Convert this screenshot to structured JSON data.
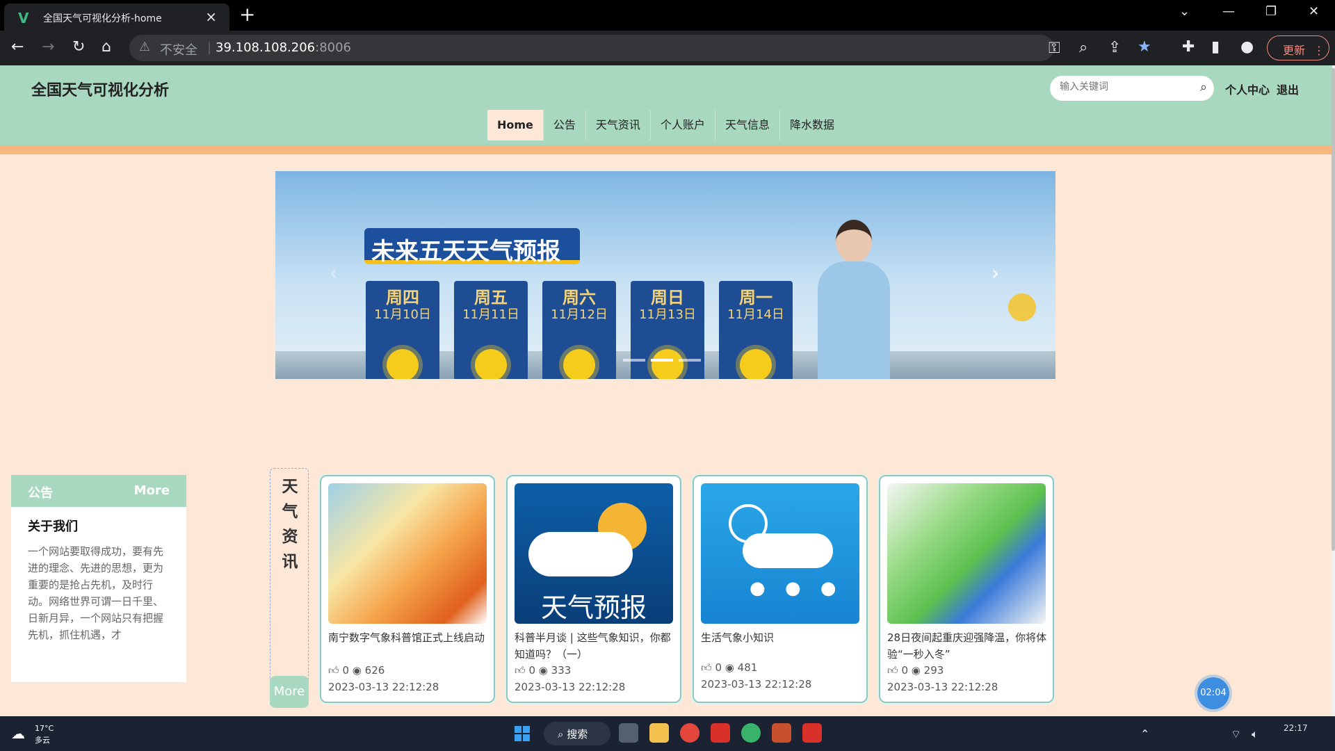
{
  "browser": {
    "tab_title": "全国天气可视化分析-home",
    "insecure_label": "不安全",
    "url_host": "39.108.108.206",
    "url_port": ":8006",
    "update_label": "更新"
  },
  "header": {
    "site_title": "全国天气可视化分析",
    "search_placeholder": "输入关键词",
    "profile_link": "个人中心",
    "logout_link": "退出",
    "nav": [
      "Home",
      "公告",
      "天气资讯",
      "个人账户",
      "天气信息",
      "降水数据"
    ],
    "active_nav": "Home"
  },
  "banner": {
    "title": "未来五天天气预报",
    "days": [
      {
        "name": "周四",
        "date": "11月10日"
      },
      {
        "name": "周五",
        "date": "11月11日"
      },
      {
        "name": "周六",
        "date": "11月12日"
      },
      {
        "name": "周日",
        "date": "11月13日"
      },
      {
        "name": "周一",
        "date": "11月14日"
      }
    ],
    "slide_count": 3,
    "active_slide": 1
  },
  "notice": {
    "heading": "公告",
    "more": "More",
    "title": "关于我们",
    "body": "一个网站要取得成功，要有先进的理念、先进的思想，更为重要的是抢占先机，及时行动。网络世界可谓一日千里、日新月异，一个网站只有把握先机，抓住机遇，才"
  },
  "news": {
    "label_chars": [
      "天",
      "气",
      "资",
      "讯"
    ],
    "more": "More",
    "items": [
      {
        "title": "南宁数字气象科普馆正式上线启动",
        "likes": "0",
        "views": "626",
        "date": "2023-03-13 22:12:28",
        "thumb": "temperature-map"
      },
      {
        "title": "科普半月谈 | 这些气象知识，你都知道吗？（一）",
        "likes": "0",
        "views": "333",
        "date": "2023-03-13 22:12:28",
        "thumb": "weather-forecast-icon",
        "thumb_text": "天气预报"
      },
      {
        "title": "生活气象小知识",
        "likes": "0",
        "views": "481",
        "date": "2023-03-13 22:12:28",
        "thumb": "rain-cloud-icon"
      },
      {
        "title": "28日夜间起重庆迎强降温，你将体验“一秒入冬”",
        "likes": "0",
        "views": "293",
        "date": "2023-03-13 22:12:28",
        "thumb": "precipitation-map"
      }
    ]
  },
  "timer": "02:04",
  "taskbar": {
    "temp": "17°C",
    "condition": "多云",
    "search_label": "搜索",
    "time": "22:17"
  },
  "colors": {
    "header_bg": "#a8d8c0",
    "page_bg": "#fde8d8",
    "accent_bar": "#f5b77e"
  }
}
